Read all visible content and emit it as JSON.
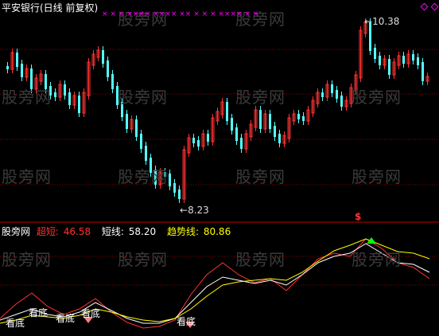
{
  "header": {
    "title": "平安银行(日线 前复权)"
  },
  "main_chart": {
    "high_label": "10.38",
    "low_label": "8.23",
    "marker_symbol": "$",
    "top_markers": "× × × ×××× ×××× ×× × × × ×××× × ×",
    "colors": {
      "up": "#ff3333",
      "down": "#55ffff",
      "marker": "#ff00ff",
      "grid": "#8b0000"
    }
  },
  "indicator_panel": {
    "name": "股旁网",
    "super_short_label": "超短:",
    "super_short_value": "46.58",
    "short_label": "短线:",
    "short_value": "58.20",
    "trend_label": "趋势线:",
    "trend_value": "80.86",
    "signal_text": "看底",
    "colors": {
      "super_short": "#ff3333",
      "short": "#ffffff",
      "trend": "#ffff00"
    }
  },
  "watermark": "股旁网"
}
